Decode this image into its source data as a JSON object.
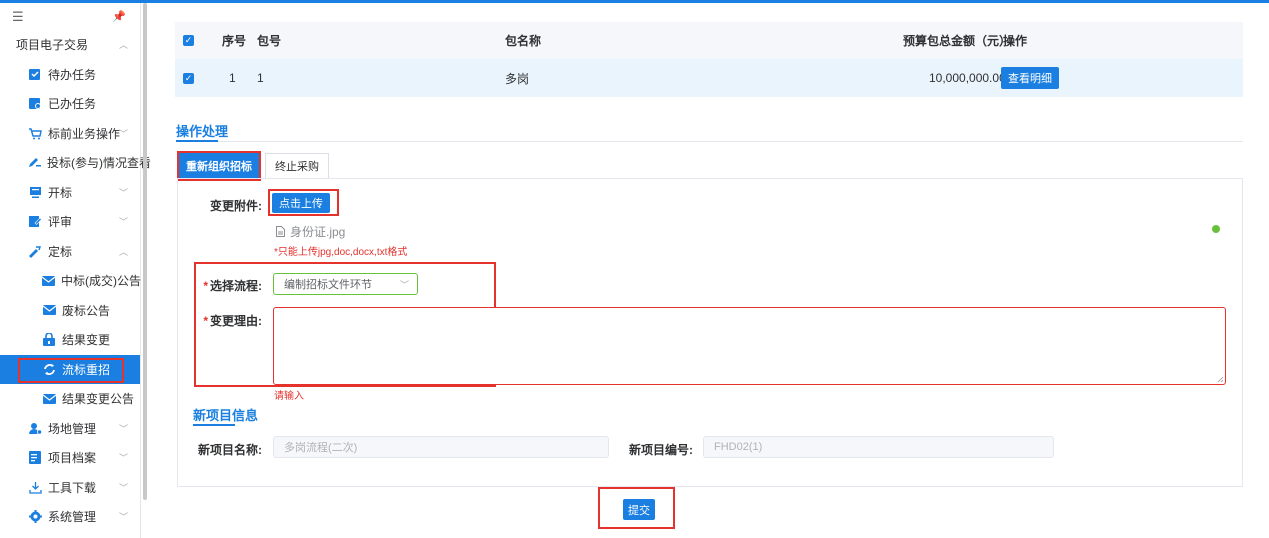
{
  "sidebar": {
    "items": [
      {
        "label": "项目电子交易",
        "icon": "folder-icon",
        "arrow": "︿"
      },
      {
        "label": "待办任务",
        "icon": "todo-icon"
      },
      {
        "label": "已办任务",
        "icon": "done-icon"
      },
      {
        "label": "标前业务操作",
        "icon": "cart-icon",
        "arrow": "﹀"
      },
      {
        "label": "投标(参与)情况查看",
        "icon": "pen-icon"
      },
      {
        "label": "开标",
        "icon": "monitor-icon",
        "arrow": "﹀"
      },
      {
        "label": "评审",
        "icon": "review-icon",
        "arrow": "﹀"
      },
      {
        "label": "定标",
        "icon": "award-icon",
        "arrow": "︿"
      },
      {
        "label": "中标(成交)公告",
        "icon": "mail-icon"
      },
      {
        "label": "废标公告",
        "icon": "mail-icon"
      },
      {
        "label": "结果变更",
        "icon": "lock-icon"
      },
      {
        "label": "流标重招",
        "icon": "refresh-icon"
      },
      {
        "label": "结果变更公告",
        "icon": "mail-icon"
      },
      {
        "label": "场地管理",
        "icon": "user-group-icon",
        "arrow": "﹀"
      },
      {
        "label": "项目档案",
        "icon": "archive-icon",
        "arrow": "﹀"
      },
      {
        "label": "工具下载",
        "icon": "download-icon",
        "arrow": "﹀"
      },
      {
        "label": "系统管理",
        "icon": "gear-icon",
        "arrow": "﹀"
      }
    ]
  },
  "table": {
    "headers": {
      "index": "序号",
      "package_no": "包号",
      "package_name": "包名称",
      "budget": "预算包总金额（元）",
      "action": "操作"
    },
    "rows": [
      {
        "index": "1",
        "package_no": "1",
        "package_name": "多岗",
        "budget": "10,000,000.00",
        "action": "查看明细"
      }
    ]
  },
  "operation": {
    "title": "操作处理",
    "tabs": [
      "重新组织招标",
      "终止采购"
    ],
    "attachment_label": "变更附件:",
    "upload_button": "点击上传",
    "file_name": "身份证.jpg",
    "format_hint": "*只能上传jpg,doc,docx,txt格式",
    "process_label": "选择流程:",
    "process_value": "编制招标文件环节",
    "reason_label": "变更理由:",
    "reason_error": "请输入",
    "status_color": "#67c23a"
  },
  "new_project": {
    "title": "新项目信息",
    "name_label": "新项目名称:",
    "name_value": "多岗流程(二次)",
    "code_label": "新项目编号:",
    "code_value": "FHD02(1)"
  },
  "submit_label": "提交",
  "colors": {
    "accent": "#1a7fe0",
    "highlight": "#e5322d",
    "success": "#67c23a"
  }
}
